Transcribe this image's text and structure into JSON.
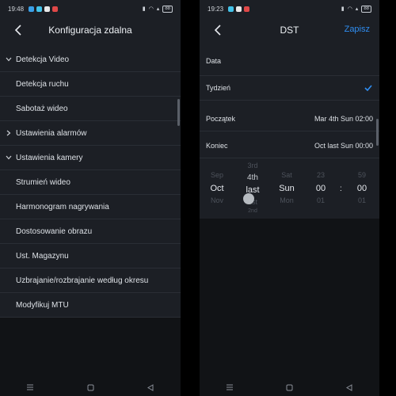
{
  "left": {
    "status": {
      "time": "19:48",
      "battery": "88"
    },
    "title": "Konfiguracja zdalna",
    "items": [
      {
        "label": "Detekcja Video",
        "section": true
      },
      {
        "label": "Detekcja ruchu",
        "section": false
      },
      {
        "label": "Sabotaż wideo",
        "section": false
      },
      {
        "label": "Ustawienia alarmów",
        "section": true,
        "collapsed": true
      },
      {
        "label": "Ustawienia kamery",
        "section": true
      },
      {
        "label": "Strumień wideo",
        "section": false
      },
      {
        "label": "Harmonogram nagrywania",
        "section": false
      },
      {
        "label": "Dostosowanie obrazu",
        "section": false
      },
      {
        "label": "Ust. Magazynu",
        "section": false
      },
      {
        "label": "Uzbrajanie/rozbrajanie według okresu",
        "section": false
      },
      {
        "label": "Modyfikuj MTU",
        "section": false
      }
    ]
  },
  "right": {
    "status": {
      "time": "19:23",
      "battery": "88"
    },
    "title": "DST",
    "save": "Zapisz",
    "data_label": "Data",
    "week_label": "Tydzień",
    "start_label": "Początek",
    "start_value": "Mar 4th Sun 02:00",
    "end_label": "Koniec",
    "end_value": "Oct last Sun 00:00",
    "picker": {
      "month": {
        "prev": "Sep",
        "sel": "Oct",
        "next": "Nov"
      },
      "week": {
        "prev2": "3rd",
        "prev": "4th",
        "sel": "last",
        "next": "1st",
        "next2": "2nd"
      },
      "day": {
        "prev": "Sat",
        "sel": "Sun",
        "next": "Mon"
      },
      "hour": {
        "prev": "23",
        "sel": "00",
        "next": "01"
      },
      "minute": {
        "prev": "59",
        "sel": "00",
        "next": "01"
      },
      "sep": ":"
    }
  },
  "colors": {
    "accent": "#2f8df0",
    "bg": "#1c1f25"
  }
}
